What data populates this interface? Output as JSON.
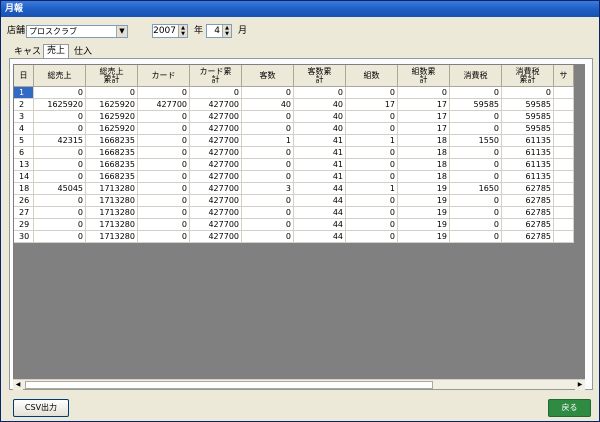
{
  "window": {
    "title": "月報"
  },
  "filters": {
    "store_label": "店舗",
    "store_value": "プロスクラブ",
    "year_value": "2007",
    "year_unit": "年",
    "month_value": "4",
    "month_unit": "月"
  },
  "tabs": [
    {
      "label": "キャスト",
      "active": false
    },
    {
      "label": "売上",
      "active": true
    },
    {
      "label": "仕入",
      "active": false
    }
  ],
  "table": {
    "columns": [
      "日",
      "総売上",
      "総売上\n累計",
      "カード",
      "カード累\n計",
      "客数",
      "客数累\n計",
      "組数",
      "組数累\n計",
      "消費税",
      "消費税\n累計",
      "サ"
    ],
    "rows": [
      [
        "1",
        "0",
        "0",
        "0",
        "0",
        "0",
        "0",
        "0",
        "0",
        "0",
        "0"
      ],
      [
        "2",
        "1625920",
        "1625920",
        "427700",
        "427700",
        "40",
        "40",
        "17",
        "17",
        "59585",
        "59585"
      ],
      [
        "3",
        "0",
        "1625920",
        "0",
        "427700",
        "0",
        "40",
        "0",
        "17",
        "0",
        "59585"
      ],
      [
        "4",
        "0",
        "1625920",
        "0",
        "427700",
        "0",
        "40",
        "0",
        "17",
        "0",
        "59585"
      ],
      [
        "5",
        "42315",
        "1668235",
        "0",
        "427700",
        "1",
        "41",
        "1",
        "18",
        "1550",
        "61135"
      ],
      [
        "6",
        "0",
        "1668235",
        "0",
        "427700",
        "0",
        "41",
        "0",
        "18",
        "0",
        "61135"
      ],
      [
        "13",
        "0",
        "1668235",
        "0",
        "427700",
        "0",
        "41",
        "0",
        "18",
        "0",
        "61135"
      ],
      [
        "14",
        "0",
        "1668235",
        "0",
        "427700",
        "0",
        "41",
        "0",
        "18",
        "0",
        "61135"
      ],
      [
        "18",
        "45045",
        "1713280",
        "0",
        "427700",
        "3",
        "44",
        "1",
        "19",
        "1650",
        "62785"
      ],
      [
        "26",
        "0",
        "1713280",
        "0",
        "427700",
        "0",
        "44",
        "0",
        "19",
        "0",
        "62785"
      ],
      [
        "27",
        "0",
        "1713280",
        "0",
        "427700",
        "0",
        "44",
        "0",
        "19",
        "0",
        "62785"
      ],
      [
        "29",
        "0",
        "1713280",
        "0",
        "427700",
        "0",
        "44",
        "0",
        "19",
        "0",
        "62785"
      ],
      [
        "30",
        "0",
        "1713280",
        "0",
        "427700",
        "0",
        "44",
        "0",
        "19",
        "0",
        "62785"
      ]
    ]
  },
  "buttons": {
    "csv_label": "CSV出力",
    "back_label": "戻る"
  }
}
